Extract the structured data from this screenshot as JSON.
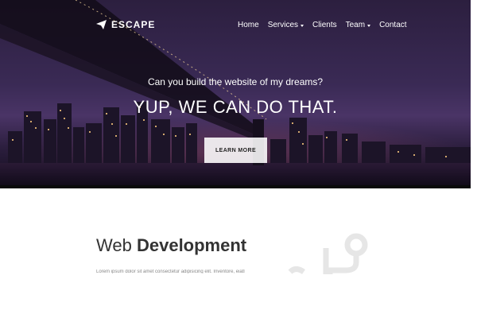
{
  "header": {
    "brand": "ESCAPE",
    "nav": [
      {
        "label": "Home",
        "dropdown": false
      },
      {
        "label": "Services",
        "dropdown": true
      },
      {
        "label": "Clients",
        "dropdown": false
      },
      {
        "label": "Team",
        "dropdown": true
      },
      {
        "label": "Contact",
        "dropdown": false
      }
    ]
  },
  "hero": {
    "subtitle": "Can you build the website of my dreams?",
    "title": "YUP, WE CAN DO THAT.",
    "cta_label": "LEARN MORE"
  },
  "section": {
    "heading_light": "Web",
    "heading_bold": "Development",
    "body": "Lorem ipsum dolor sit amet consectetur adipisicing elit. Inventore, eiatl"
  },
  "colors": {
    "hero_overlay": "#3a2a55",
    "button_bg": "#ffffff",
    "text_dark": "#333333",
    "icon_gray": "#e5e5e5"
  },
  "icons": {
    "logo": "paper-plane-icon",
    "section": "code-branch-icon"
  }
}
